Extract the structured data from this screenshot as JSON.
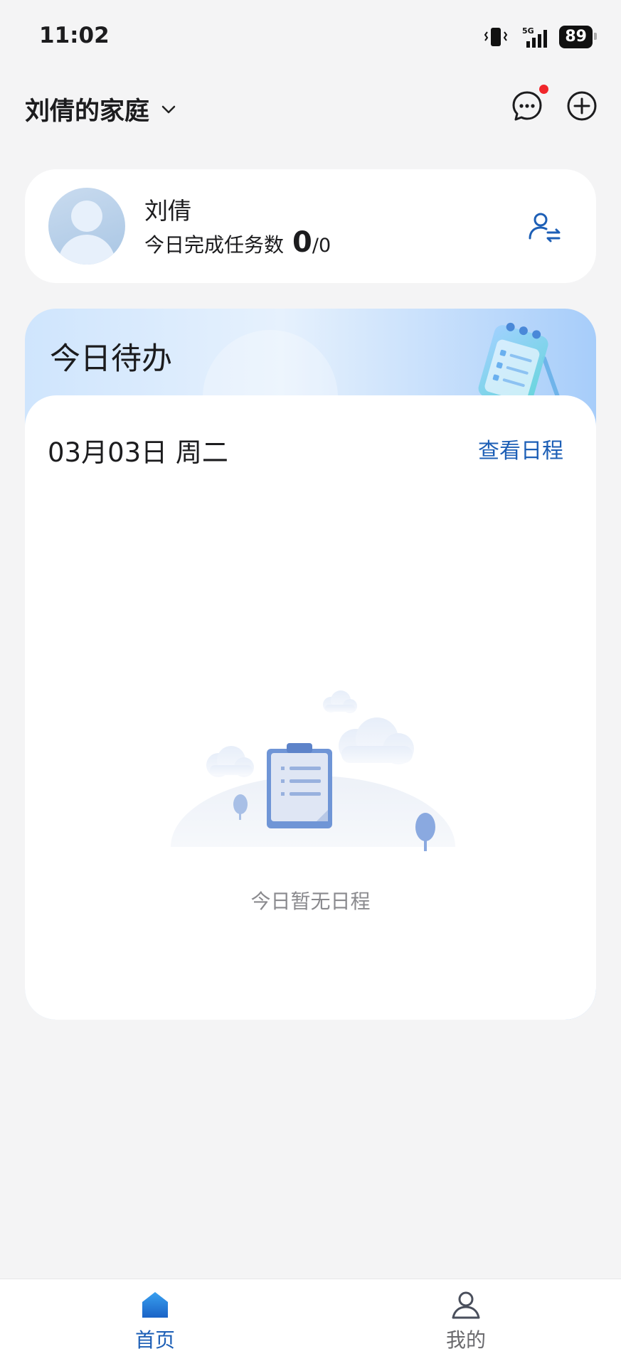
{
  "status": {
    "time": "11:02",
    "network": "5G",
    "battery": "89"
  },
  "header": {
    "family_name": "刘倩的家庭"
  },
  "user": {
    "name": "刘倩",
    "task_label": "今日完成任务数",
    "done_count": "0",
    "total": "/0"
  },
  "todo": {
    "title": "今日待办",
    "date": "03月03日 周二",
    "view_schedule": "查看日程",
    "empty_text": "今日暂无日程"
  },
  "tabs": [
    {
      "label": "首页",
      "icon": "home-icon",
      "active": true
    },
    {
      "label": "我的",
      "icon": "person-icon",
      "active": false
    }
  ],
  "colors": {
    "accent": "#1d5fb6",
    "notification": "#f0262b",
    "background": "#f4f4f5"
  }
}
